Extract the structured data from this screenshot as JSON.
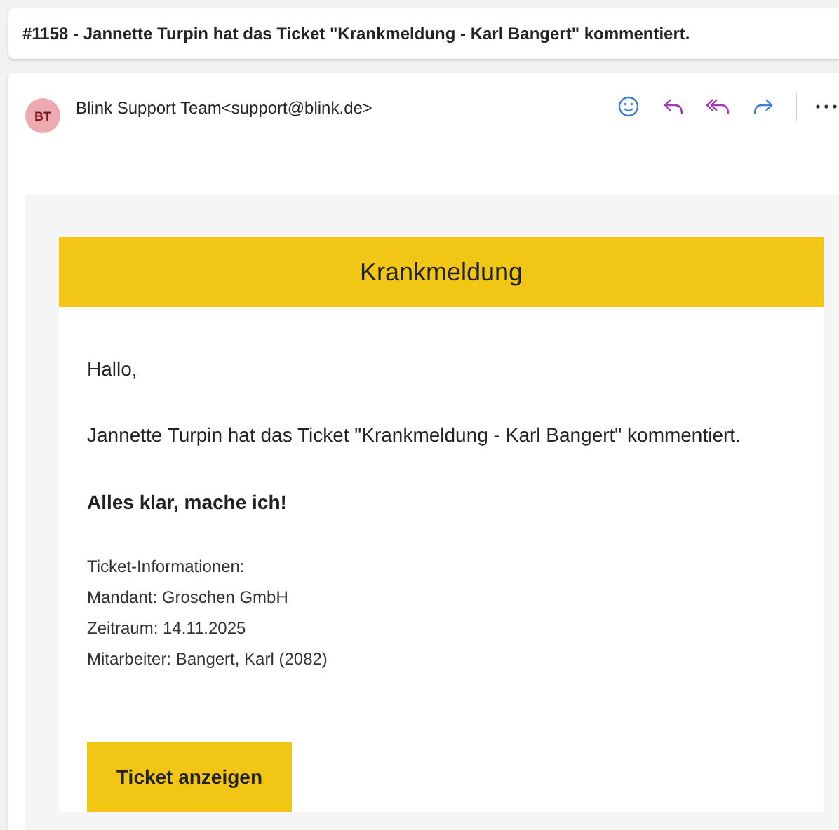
{
  "subject": "#1158 - Jannette Turpin hat das Ticket \"Krankmeldung - Karl Bangert\" kommentiert.",
  "sender": {
    "initials": "BT",
    "name": "Blink Support Team<support@blink.de>"
  },
  "actions": [
    {
      "kind": "emoji"
    },
    {
      "kind": "reply"
    },
    {
      "kind": "reply-all"
    },
    {
      "kind": "forward"
    },
    {
      "kind": "more"
    }
  ],
  "message": {
    "heading": "Krankmeldung",
    "greeting": "Hallo,",
    "text": "Jannette Turpin hat das Ticket \"Krankmeldung - Karl Bangert\" kommentiert.",
    "comment": "Alles klar, mache ich!",
    "info": [
      "Ticket-Informationen:",
      "Mandant: Groschen GmbH",
      "Zeitraum: 14.11.2025",
      "Mitarbeiter: Bangert, Karl (2082)"
    ],
    "button": "Ticket anzeigen"
  }
}
